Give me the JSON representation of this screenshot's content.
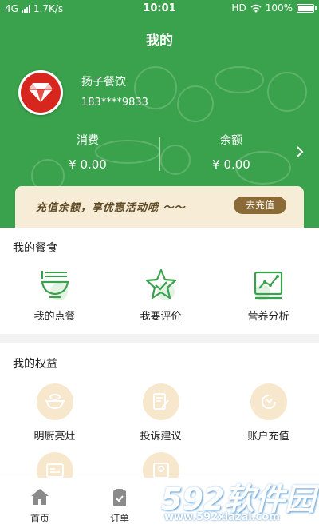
{
  "status_bar": {
    "network": "4G",
    "speed": "1.7K/s",
    "time": "10:01",
    "hd": "HD",
    "battery": "100%"
  },
  "header": {
    "title": "我的",
    "accent_color": "#3aa14c"
  },
  "profile": {
    "name": "扬子餐饮",
    "phone": "183****9833",
    "avatar_icon": "red-diamond-logo"
  },
  "stats": [
    {
      "label": "消费",
      "value": "¥ 0.00"
    },
    {
      "label": "余额",
      "value": "¥ 0.00"
    }
  ],
  "promo": {
    "text": "充值余额，享优惠活动哦 ～～",
    "button": "去充值"
  },
  "my_meals": {
    "title": "我的餐食",
    "items": [
      {
        "label": "我的点餐",
        "icon": "bowl-icon"
      },
      {
        "label": "我要评价",
        "icon": "star-icon"
      },
      {
        "label": "营养分析",
        "icon": "chart-icon"
      }
    ]
  },
  "my_rights": {
    "title": "我的权益",
    "items": [
      {
        "label": "明厨亮灶",
        "icon": "cooking-pot-icon"
      },
      {
        "label": "投诉建议",
        "icon": "edit-doc-icon"
      },
      {
        "label": "账户充值",
        "icon": "recharge-icon"
      }
    ]
  },
  "tabs": [
    {
      "label": "首页",
      "icon": "home-icon"
    },
    {
      "label": "订单",
      "icon": "clipboard-icon"
    }
  ],
  "watermark": {
    "brand": "592软件园",
    "url": "www.592xiazai.com"
  }
}
